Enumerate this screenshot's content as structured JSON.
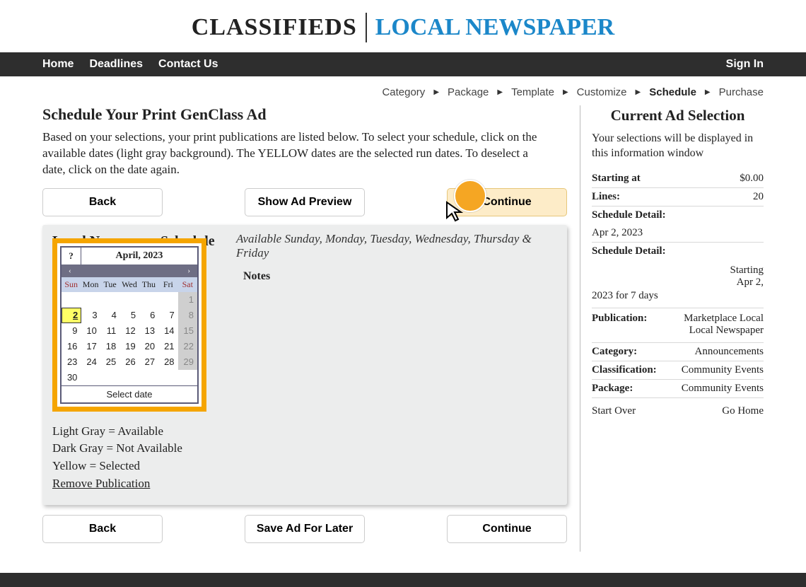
{
  "header": {
    "left": "CLASSIFIEDS",
    "right": "LOCAL NEWSPAPER"
  },
  "nav": {
    "home": "Home",
    "deadlines": "Deadlines",
    "contact": "Contact Us",
    "signin": "Sign In"
  },
  "breadcrumb": {
    "steps": [
      "Category",
      "Package",
      "Template",
      "Customize",
      "Schedule",
      "Purchase"
    ],
    "active_index": 4
  },
  "page": {
    "title": "Schedule Your Print GenClass Ad",
    "intro": "Based on your selections, your print publications are listed below. To select your schedule, click on the available dates (light gray background). The YELLOW dates are the selected run dates. To deselect a date, click on the date again."
  },
  "buttons": {
    "back": "Back",
    "preview": "Show Ad Preview",
    "continue": "Continue",
    "save_later": "Save Ad For Later"
  },
  "schedule": {
    "title": "Local Newspaper Schedule",
    "availability": "Available Sunday, Monday, Tuesday, Wednesday, Thursday & Friday",
    "notes_label": "Notes"
  },
  "calendar": {
    "help": "?",
    "month_label": "April, 2023",
    "prev": "‹",
    "next": "›",
    "dow": [
      "Sun",
      "Mon",
      "Tue",
      "Wed",
      "Thu",
      "Fri",
      "Sat"
    ],
    "rows": [
      [
        {
          "n": "",
          "c": "empty"
        },
        {
          "n": "",
          "c": "empty"
        },
        {
          "n": "",
          "c": "empty"
        },
        {
          "n": "",
          "c": "empty"
        },
        {
          "n": "",
          "c": "empty"
        },
        {
          "n": "",
          "c": "empty"
        },
        {
          "n": "1",
          "c": "na"
        }
      ],
      [
        {
          "n": "2",
          "c": "sel"
        },
        {
          "n": "3",
          "c": ""
        },
        {
          "n": "4",
          "c": ""
        },
        {
          "n": "5",
          "c": ""
        },
        {
          "n": "6",
          "c": ""
        },
        {
          "n": "7",
          "c": ""
        },
        {
          "n": "8",
          "c": "na"
        }
      ],
      [
        {
          "n": "9",
          "c": ""
        },
        {
          "n": "10",
          "c": ""
        },
        {
          "n": "11",
          "c": ""
        },
        {
          "n": "12",
          "c": ""
        },
        {
          "n": "13",
          "c": ""
        },
        {
          "n": "14",
          "c": ""
        },
        {
          "n": "15",
          "c": "na"
        }
      ],
      [
        {
          "n": "16",
          "c": ""
        },
        {
          "n": "17",
          "c": ""
        },
        {
          "n": "18",
          "c": ""
        },
        {
          "n": "19",
          "c": ""
        },
        {
          "n": "20",
          "c": ""
        },
        {
          "n": "21",
          "c": ""
        },
        {
          "n": "22",
          "c": "na"
        }
      ],
      [
        {
          "n": "23",
          "c": ""
        },
        {
          "n": "24",
          "c": ""
        },
        {
          "n": "25",
          "c": ""
        },
        {
          "n": "26",
          "c": ""
        },
        {
          "n": "27",
          "c": ""
        },
        {
          "n": "28",
          "c": ""
        },
        {
          "n": "29",
          "c": "na"
        }
      ],
      [
        {
          "n": "30",
          "c": ""
        },
        {
          "n": "",
          "c": "empty"
        },
        {
          "n": "",
          "c": "empty"
        },
        {
          "n": "",
          "c": "empty"
        },
        {
          "n": "",
          "c": "empty"
        },
        {
          "n": "",
          "c": "empty"
        },
        {
          "n": "",
          "c": "empty"
        }
      ]
    ],
    "footer": "Select date"
  },
  "legend": {
    "l1": "Light Gray = Available",
    "l2": "Dark Gray = Not Available",
    "l3": "Yellow = Selected",
    "remove": "Remove Publication"
  },
  "sidebar": {
    "title": "Current Ad Selection",
    "intro": "Your selections will be displayed in this information window",
    "starting_at_label": "Starting at",
    "starting_at_value": "$0.00",
    "lines_label": "Lines:",
    "lines_value": "20",
    "sched_detail_label": "Schedule Detail:",
    "sched_date": "Apr 2, 2023",
    "sched_detail2_right1": "Starting",
    "sched_detail2_right2": "Apr 2,",
    "sched_detail2_full": "2023 for 7 days",
    "pub_label": "Publication:",
    "pub_value1": "Marketplace Local",
    "pub_value2": "Local Newspaper",
    "cat_label": "Category:",
    "cat_value": "Announcements",
    "class_label": "Classification:",
    "class_value": "Community Events",
    "pkg_label": "Package:",
    "pkg_value": "Community Events",
    "start_over": "Start Over",
    "go_home": "Go Home"
  }
}
